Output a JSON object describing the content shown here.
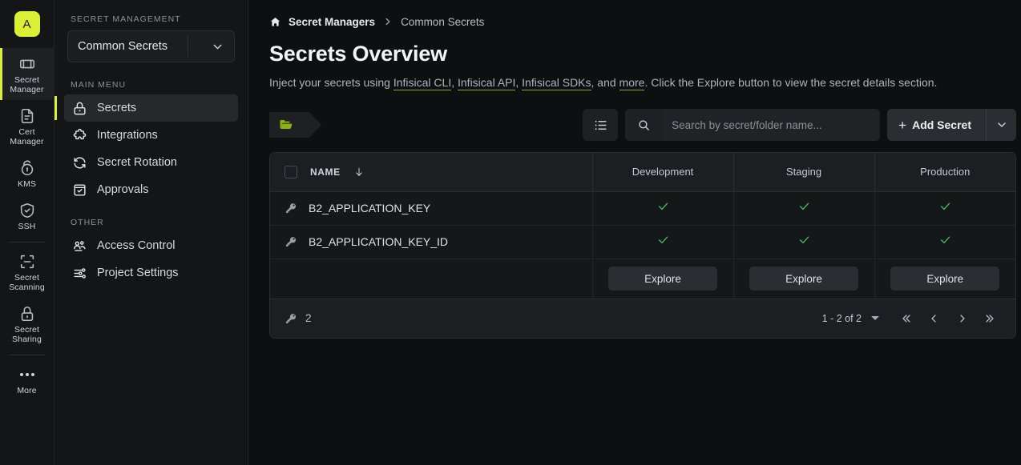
{
  "rail": {
    "avatar_letter": "A",
    "items": [
      {
        "label": "Secret\nManager",
        "icon": "secret-manager-icon",
        "active": true
      },
      {
        "label": "Cert\nManager",
        "icon": "cert-manager-icon",
        "active": false
      },
      {
        "label": "KMS",
        "icon": "kms-icon",
        "active": false
      },
      {
        "label": "SSH",
        "icon": "ssh-shield-icon",
        "active": false
      },
      {
        "label": "Secret\nScanning",
        "icon": "secret-scanning-icon",
        "active": false
      },
      {
        "label": "Secret\nSharing",
        "icon": "secret-sharing-lock-icon",
        "active": false
      },
      {
        "label": "More",
        "icon": "more-dots-icon",
        "active": false
      }
    ]
  },
  "sidebar": {
    "section_caption": "SECRET MANAGEMENT",
    "project": {
      "name": "Common Secrets"
    },
    "main_menu_caption": "MAIN MENU",
    "main_menu": [
      {
        "label": "Secrets",
        "icon": "lock-icon",
        "active": true
      },
      {
        "label": "Integrations",
        "icon": "puzzle-icon",
        "active": false
      },
      {
        "label": "Secret Rotation",
        "icon": "rotate-icon",
        "active": false
      },
      {
        "label": "Approvals",
        "icon": "approvals-icon",
        "active": false
      }
    ],
    "other_caption": "OTHER",
    "other_menu": [
      {
        "label": "Access Control",
        "icon": "users-icon",
        "active": false
      },
      {
        "label": "Project Settings",
        "icon": "sliders-icon",
        "active": false
      }
    ]
  },
  "breadcrumb": {
    "root": "Secret Managers",
    "current": "Common Secrets"
  },
  "header": {
    "title": "Secrets Overview",
    "subtitle_parts": {
      "p1": "Inject your secrets using ",
      "link1": "Infisical CLI",
      "p2": ", ",
      "link2": "Infisical API",
      "p3": ", ",
      "link3": "Infisical SDKs",
      "p4": ", and ",
      "link4": "more",
      "p5": ". Click the Explore button to view the secret details section."
    }
  },
  "toolbar": {
    "folder_chip_icon": "open-folder-icon",
    "list_view_label": "list-view",
    "search": {
      "placeholder": "Search by secret/folder name...",
      "value": ""
    },
    "add_secret_label": "Add Secret",
    "add_secret_plus": "+"
  },
  "table": {
    "columns": {
      "name": "NAME",
      "environments": [
        "Development",
        "Staging",
        "Production"
      ]
    },
    "rows": [
      {
        "name": "B2_APPLICATION_KEY",
        "values": [
          "check",
          "check",
          "check"
        ]
      },
      {
        "name": "B2_APPLICATION_KEY_ID",
        "values": [
          "check",
          "check",
          "check"
        ]
      }
    ],
    "explore_label": "Explore",
    "footer": {
      "secret_count": "2",
      "page_range": "1 - 2 of 2"
    }
  },
  "colors": {
    "accent": "#dbf035",
    "folder_green": "#8db312",
    "check_green": "#3cb95a"
  }
}
